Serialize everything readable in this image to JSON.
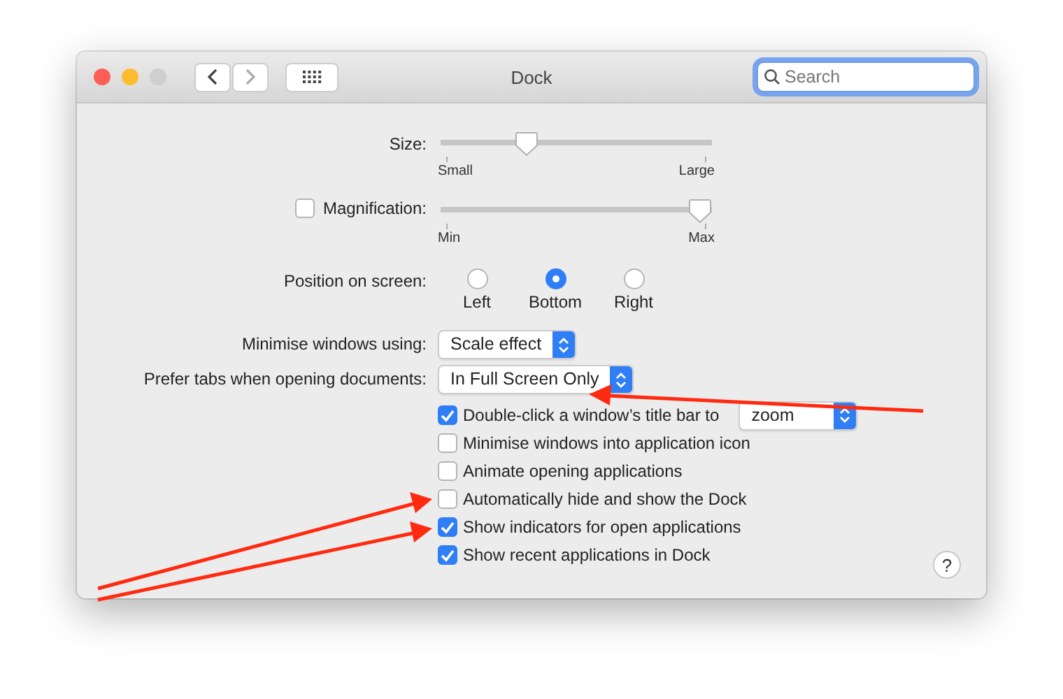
{
  "window": {
    "title": "Dock"
  },
  "search": {
    "placeholder": "Search",
    "focused": true
  },
  "size": {
    "label": "Size:",
    "level": 0.3,
    "min_label": "Small",
    "max_label": "Large"
  },
  "magnification": {
    "label": "Magnification:",
    "checked": false,
    "level": 1.0,
    "min_label": "Min",
    "max_label": "Max"
  },
  "position": {
    "label": "Position on screen:",
    "options": [
      {
        "label": "Left",
        "selected": false
      },
      {
        "label": "Bottom",
        "selected": true
      },
      {
        "label": "Right",
        "selected": false
      }
    ]
  },
  "popups": [
    {
      "label": "Minimise windows using:",
      "value": "Scale effect"
    },
    {
      "label": "Prefer tabs when opening documents:",
      "value": "In Full Screen Only"
    }
  ],
  "checkboxes": [
    {
      "label": "Double-click a window’s title bar to",
      "checked": true,
      "popup": "zoom"
    },
    {
      "label": "Minimise windows into application icon",
      "checked": false
    },
    {
      "label": "Animate opening applications",
      "checked": false
    },
    {
      "label": "Automatically hide and show the Dock",
      "checked": false
    },
    {
      "label": "Show indicators for open applications",
      "checked": true
    },
    {
      "label": "Show recent applications in Dock",
      "checked": true
    }
  ],
  "help": "?"
}
